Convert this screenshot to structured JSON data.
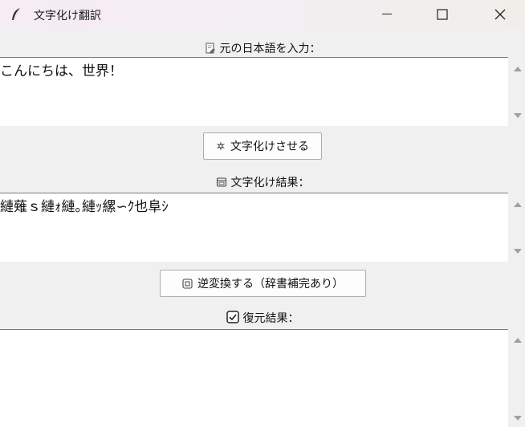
{
  "window": {
    "title": "文字化け翻訳",
    "icon": "feather-icon",
    "controls": [
      "minimize",
      "maximize",
      "close"
    ]
  },
  "input_section": {
    "label": "元の日本語を入力：",
    "icon": "document-edit-icon",
    "text": "こんにちは、世界！"
  },
  "garble_button": {
    "label": "文字化けさせる",
    "icon": "sparkle-gear-icon"
  },
  "garbled_section": {
    "label": "文字化け結果：",
    "icon": "window-icon",
    "text": "縺薙ｓ縺ｫ縺｡縺ｯ縲∽ｸ也阜ｼ"
  },
  "reverse_button": {
    "label": "逆変換する（辞書補完あり）",
    "icon": "restore-icon"
  },
  "restored_section": {
    "label": "復元結果：",
    "icon": "check-box-icon",
    "text": ""
  }
}
